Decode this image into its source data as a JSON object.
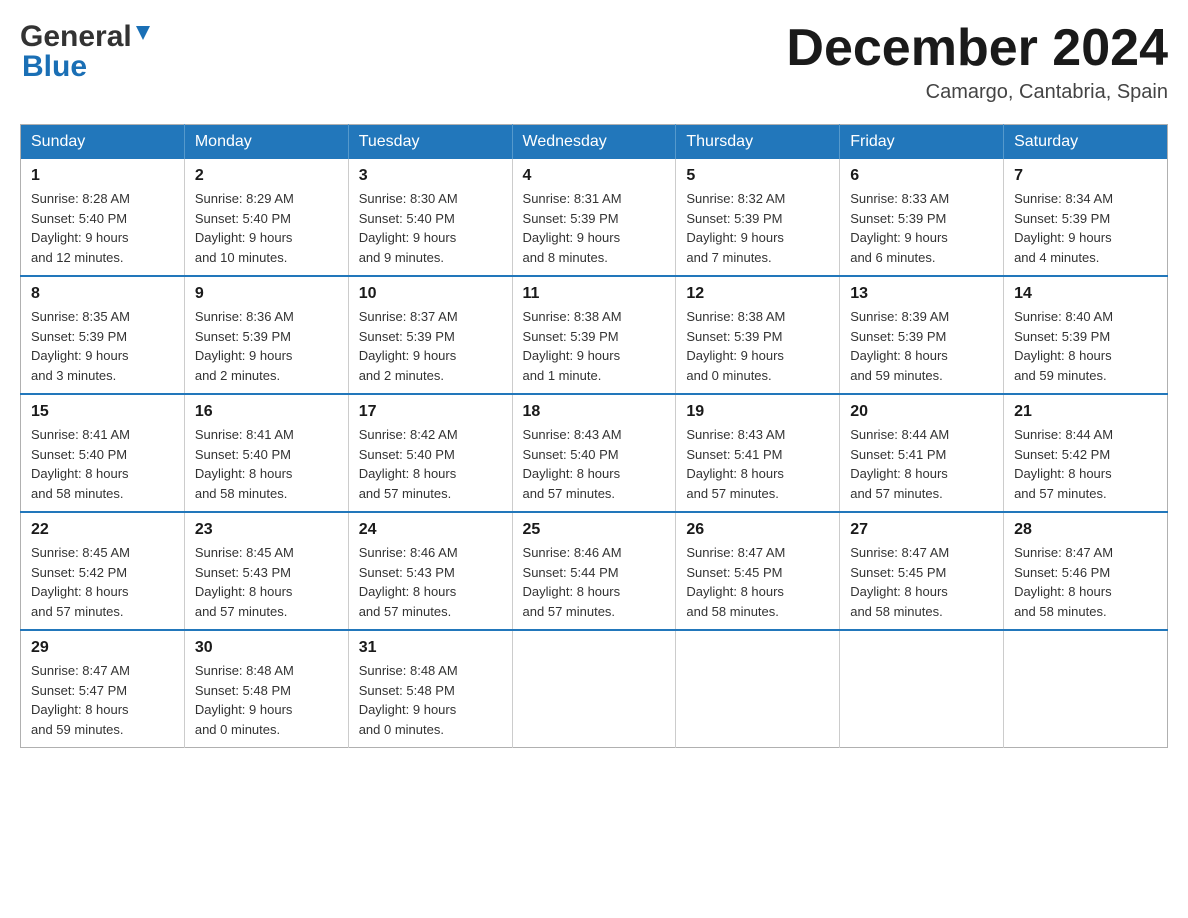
{
  "logo": {
    "general": "General",
    "blue": "Blue"
  },
  "title": "December 2024",
  "location": "Camargo, Cantabria, Spain",
  "weekdays": [
    "Sunday",
    "Monday",
    "Tuesday",
    "Wednesday",
    "Thursday",
    "Friday",
    "Saturday"
  ],
  "weeks": [
    [
      {
        "day": "1",
        "sunrise": "8:28 AM",
        "sunset": "5:40 PM",
        "daylight": "9 hours and 12 minutes."
      },
      {
        "day": "2",
        "sunrise": "8:29 AM",
        "sunset": "5:40 PM",
        "daylight": "9 hours and 10 minutes."
      },
      {
        "day": "3",
        "sunrise": "8:30 AM",
        "sunset": "5:40 PM",
        "daylight": "9 hours and 9 minutes."
      },
      {
        "day": "4",
        "sunrise": "8:31 AM",
        "sunset": "5:39 PM",
        "daylight": "9 hours and 8 minutes."
      },
      {
        "day": "5",
        "sunrise": "8:32 AM",
        "sunset": "5:39 PM",
        "daylight": "9 hours and 7 minutes."
      },
      {
        "day": "6",
        "sunrise": "8:33 AM",
        "sunset": "5:39 PM",
        "daylight": "9 hours and 6 minutes."
      },
      {
        "day": "7",
        "sunrise": "8:34 AM",
        "sunset": "5:39 PM",
        "daylight": "9 hours and 4 minutes."
      }
    ],
    [
      {
        "day": "8",
        "sunrise": "8:35 AM",
        "sunset": "5:39 PM",
        "daylight": "9 hours and 3 minutes."
      },
      {
        "day": "9",
        "sunrise": "8:36 AM",
        "sunset": "5:39 PM",
        "daylight": "9 hours and 2 minutes."
      },
      {
        "day": "10",
        "sunrise": "8:37 AM",
        "sunset": "5:39 PM",
        "daylight": "9 hours and 2 minutes."
      },
      {
        "day": "11",
        "sunrise": "8:38 AM",
        "sunset": "5:39 PM",
        "daylight": "9 hours and 1 minute."
      },
      {
        "day": "12",
        "sunrise": "8:38 AM",
        "sunset": "5:39 PM",
        "daylight": "9 hours and 0 minutes."
      },
      {
        "day": "13",
        "sunrise": "8:39 AM",
        "sunset": "5:39 PM",
        "daylight": "8 hours and 59 minutes."
      },
      {
        "day": "14",
        "sunrise": "8:40 AM",
        "sunset": "5:39 PM",
        "daylight": "8 hours and 59 minutes."
      }
    ],
    [
      {
        "day": "15",
        "sunrise": "8:41 AM",
        "sunset": "5:40 PM",
        "daylight": "8 hours and 58 minutes."
      },
      {
        "day": "16",
        "sunrise": "8:41 AM",
        "sunset": "5:40 PM",
        "daylight": "8 hours and 58 minutes."
      },
      {
        "day": "17",
        "sunrise": "8:42 AM",
        "sunset": "5:40 PM",
        "daylight": "8 hours and 57 minutes."
      },
      {
        "day": "18",
        "sunrise": "8:43 AM",
        "sunset": "5:40 PM",
        "daylight": "8 hours and 57 minutes."
      },
      {
        "day": "19",
        "sunrise": "8:43 AM",
        "sunset": "5:41 PM",
        "daylight": "8 hours and 57 minutes."
      },
      {
        "day": "20",
        "sunrise": "8:44 AM",
        "sunset": "5:41 PM",
        "daylight": "8 hours and 57 minutes."
      },
      {
        "day": "21",
        "sunrise": "8:44 AM",
        "sunset": "5:42 PM",
        "daylight": "8 hours and 57 minutes."
      }
    ],
    [
      {
        "day": "22",
        "sunrise": "8:45 AM",
        "sunset": "5:42 PM",
        "daylight": "8 hours and 57 minutes."
      },
      {
        "day": "23",
        "sunrise": "8:45 AM",
        "sunset": "5:43 PM",
        "daylight": "8 hours and 57 minutes."
      },
      {
        "day": "24",
        "sunrise": "8:46 AM",
        "sunset": "5:43 PM",
        "daylight": "8 hours and 57 minutes."
      },
      {
        "day": "25",
        "sunrise": "8:46 AM",
        "sunset": "5:44 PM",
        "daylight": "8 hours and 57 minutes."
      },
      {
        "day": "26",
        "sunrise": "8:47 AM",
        "sunset": "5:45 PM",
        "daylight": "8 hours and 58 minutes."
      },
      {
        "day": "27",
        "sunrise": "8:47 AM",
        "sunset": "5:45 PM",
        "daylight": "8 hours and 58 minutes."
      },
      {
        "day": "28",
        "sunrise": "8:47 AM",
        "sunset": "5:46 PM",
        "daylight": "8 hours and 58 minutes."
      }
    ],
    [
      {
        "day": "29",
        "sunrise": "8:47 AM",
        "sunset": "5:47 PM",
        "daylight": "8 hours and 59 minutes."
      },
      {
        "day": "30",
        "sunrise": "8:48 AM",
        "sunset": "5:48 PM",
        "daylight": "9 hours and 0 minutes."
      },
      {
        "day": "31",
        "sunrise": "8:48 AM",
        "sunset": "5:48 PM",
        "daylight": "9 hours and 0 minutes."
      },
      null,
      null,
      null,
      null
    ]
  ],
  "labels": {
    "sunrise": "Sunrise:",
    "sunset": "Sunset:",
    "daylight": "Daylight:"
  }
}
